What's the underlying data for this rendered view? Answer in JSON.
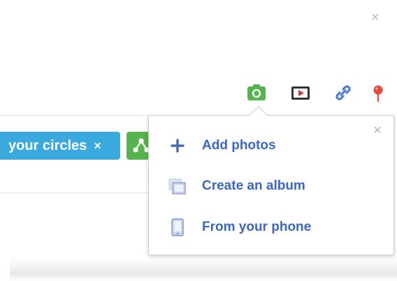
{
  "icons": {
    "close": "close-icon",
    "photo": "camera-icon",
    "video": "video-icon",
    "link": "link-icon",
    "location": "location-pin-icon"
  },
  "colors": {
    "photo_green": "#55b44b",
    "link_blue": "#3b66c8",
    "chip_blue": "#3aa9dd",
    "pin_red": "#e54b3c"
  },
  "compose": {
    "circles_chip": {
      "label": "your circles",
      "remove": "×"
    }
  },
  "popup": {
    "close": "×",
    "items": [
      {
        "label": "Add photos",
        "icon": "plus-icon"
      },
      {
        "label": "Create an album",
        "icon": "album-icon"
      },
      {
        "label": "From your phone",
        "icon": "phone-icon"
      }
    ]
  }
}
